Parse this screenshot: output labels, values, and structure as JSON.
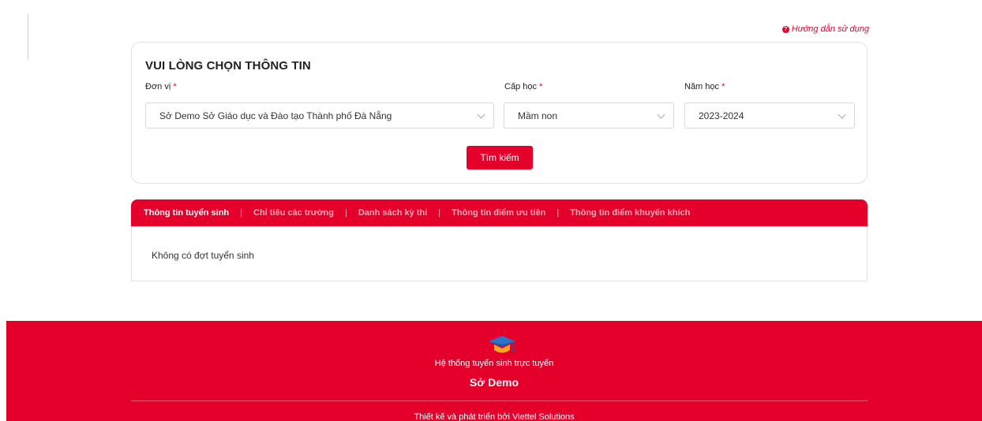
{
  "help_link": {
    "label": "Hướng dẫn sử dụng"
  },
  "form": {
    "title": "VUI LÒNG CHỌN THÔNG TIN",
    "don_vi": {
      "label": "Đơn vị",
      "required": "*",
      "value": "Sở Demo Sở Giáo dục và Đào tạo Thành phố Đà Nẵng"
    },
    "cap_hoc": {
      "label": "Cấp học",
      "required": "*",
      "value": "Mầm non"
    },
    "nam_hoc": {
      "label": "Năm học",
      "required": "*",
      "value": "2023-2024"
    },
    "search_button": "Tìm kiếm"
  },
  "tabs": [
    {
      "label": "Thông tin tuyển sinh",
      "active": true
    },
    {
      "label": "Chỉ tiêu các trường",
      "active": false
    },
    {
      "label": "Danh sách kỳ thi",
      "active": false
    },
    {
      "label": "Thông tin điểm ưu tiên",
      "active": false
    },
    {
      "label": "Thông tin điểm khuyến khích",
      "active": false
    }
  ],
  "tab_content": {
    "message": "Không có đợt tuyển sinh"
  },
  "footer": {
    "logo_icon": "graduation-cap-icon",
    "system_name": "Hệ thống tuyển sinh trực tuyến",
    "organization": "Sở Demo",
    "credit": "Thiết kế và phát triển bởi Viettel Solutions"
  },
  "colors": {
    "brand": "#e4002b",
    "tab_inactive": "#f7aab8",
    "border": "#e2e2e2"
  }
}
